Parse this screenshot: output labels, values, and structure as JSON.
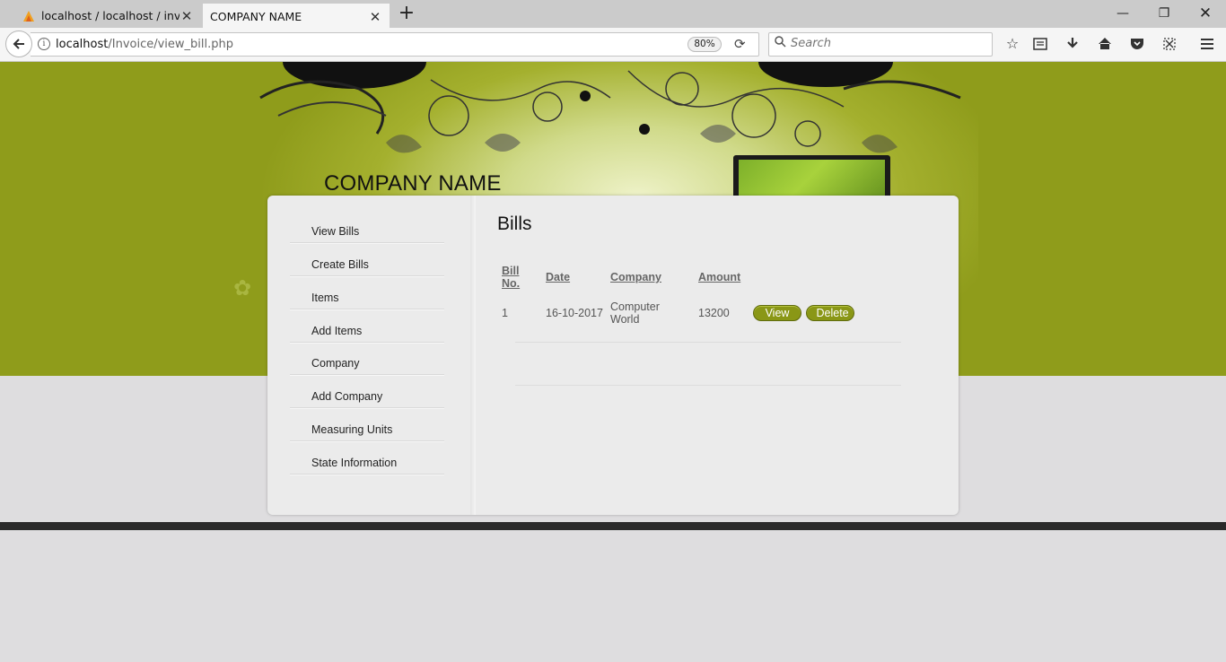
{
  "browser": {
    "tabs": [
      {
        "label": "localhost / localhost / invoic",
        "active": false
      },
      {
        "label": "COMPANY NAME",
        "active": true
      }
    ],
    "url_host": "localhost",
    "url_path": "/Invoice/view_bill.php",
    "zoom": "80%",
    "search_placeholder": "Search",
    "window_controls": [
      "minimize-icon",
      "restore-icon",
      "close-icon"
    ],
    "toolbar_icons": [
      "bookmark-star-icon",
      "reading-list-icon",
      "download-icon",
      "home-icon",
      "pocket-icon",
      "screenshot-icon",
      "menu-icon"
    ]
  },
  "site": {
    "company_name": "COMPANY NAME"
  },
  "sidebar": {
    "items": [
      {
        "label": "View Bills"
      },
      {
        "label": "Create Bills"
      },
      {
        "label": "Items"
      },
      {
        "label": "Add Items"
      },
      {
        "label": "Company"
      },
      {
        "label": "Add Company"
      },
      {
        "label": "Measuring Units"
      },
      {
        "label": "State Information"
      }
    ]
  },
  "main": {
    "title": "Bills",
    "columns": [
      "Bill No.",
      "Date",
      "Company",
      "Amount"
    ],
    "rows": [
      {
        "bill_no": "1",
        "date": "16-10-2017",
        "company": "Computer World",
        "amount": "13200",
        "view_label": "View",
        "delete_label": "Delete"
      }
    ]
  },
  "colors": {
    "header_green": "#8f9c1b",
    "button_green": "#8a9716",
    "page_bg": "#dedddf",
    "footer_strip": "#2a2a2a"
  }
}
